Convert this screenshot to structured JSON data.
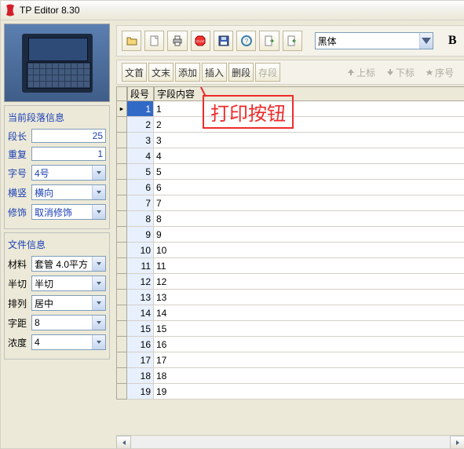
{
  "title": "TP Editor  8.30",
  "callout": "打印按钮",
  "font": {
    "value": "黑体",
    "bold": "B"
  },
  "toolbar2": {
    "b1": "文首",
    "b2": "文末",
    "b3": "添加",
    "b4": "插入",
    "b5": "删段",
    "b6": "存段",
    "l1": "上标",
    "l2": "下标",
    "l3": "序号"
  },
  "panel1": {
    "title": "当前段落信息",
    "rows": {
      "duanchang": {
        "label": "段长",
        "value": "25"
      },
      "chongfu": {
        "label": "重复",
        "value": "1"
      },
      "zihao": {
        "label": "字号",
        "value": "4号"
      },
      "hengshu": {
        "label": "横竖",
        "value": "横向"
      },
      "xiushi": {
        "label": "修饰",
        "value": "取消修饰"
      }
    }
  },
  "panel2": {
    "title": "文件信息",
    "rows": {
      "cailiao": {
        "label": "材料",
        "value": "套管 4.0平方"
      },
      "banqie": {
        "label": "半切",
        "value": "半切"
      },
      "pailie": {
        "label": "排列",
        "value": "居中"
      },
      "ziju": {
        "label": "字距",
        "value": "8"
      },
      "nongdu": {
        "label": "浓度",
        "value": "4"
      }
    }
  },
  "grid": {
    "headers": {
      "c1": "段号",
      "c2": "字段内容"
    },
    "rows": [
      {
        "n": "1",
        "v": "1"
      },
      {
        "n": "2",
        "v": "2"
      },
      {
        "n": "3",
        "v": "3"
      },
      {
        "n": "4",
        "v": "4"
      },
      {
        "n": "5",
        "v": "5"
      },
      {
        "n": "6",
        "v": "6"
      },
      {
        "n": "7",
        "v": "7"
      },
      {
        "n": "8",
        "v": "8"
      },
      {
        "n": "9",
        "v": "9"
      },
      {
        "n": "10",
        "v": "10"
      },
      {
        "n": "11",
        "v": "11"
      },
      {
        "n": "12",
        "v": "12"
      },
      {
        "n": "13",
        "v": "13"
      },
      {
        "n": "14",
        "v": "14"
      },
      {
        "n": "15",
        "v": "15"
      },
      {
        "n": "16",
        "v": "16"
      },
      {
        "n": "17",
        "v": "17"
      },
      {
        "n": "18",
        "v": "18"
      },
      {
        "n": "19",
        "v": "19"
      }
    ]
  }
}
